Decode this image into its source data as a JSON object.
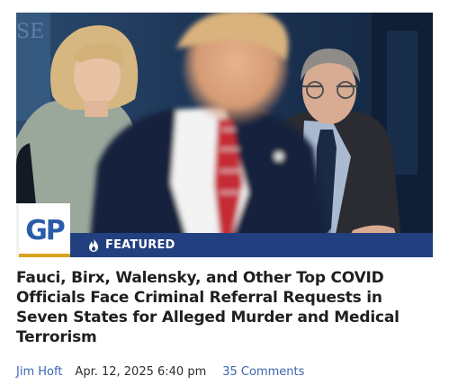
{
  "article": {
    "brand_logo_text": "GP",
    "badge_label": "FEATURED",
    "headline": "Fauci, Birx, Walensky, and Other Top COVID Officials Face Criminal Referral Requests in Seven States for Alleged Murder and Medical Terrorism",
    "author": "Jim Hoft",
    "date": "Apr. 12, 2025 6:40 pm",
    "comments": "35 Comments",
    "hero_backdrop_text": "SE"
  },
  "colors": {
    "badge_band": "#22407f",
    "logo_blue": "#2b5caa",
    "logo_gold": "#d9a321",
    "link": "#3a66b2",
    "headline": "#1f1f1f"
  },
  "icons": {
    "badge": "flame-icon"
  }
}
